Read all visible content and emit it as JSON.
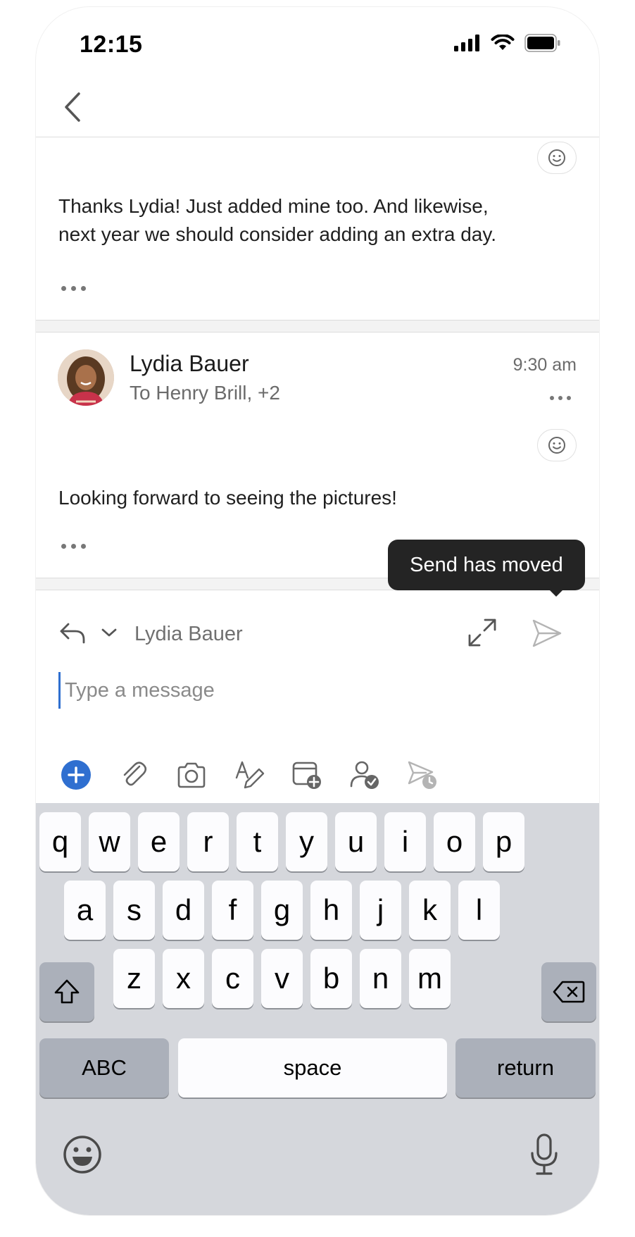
{
  "status_bar": {
    "time": "12:15"
  },
  "messages": [
    {
      "body": [
        "Thanks Lydia! Just added mine too. And likewise,",
        "next year we should consider adding an extra day."
      ]
    },
    {
      "sender": "Lydia Bauer",
      "recipients": "To Henry Brill, +2",
      "time": "9:30 am",
      "body": [
        "Looking forward to seeing the pictures!"
      ]
    }
  ],
  "tooltip": {
    "text": "Send has moved"
  },
  "compose": {
    "reply_to": "Lydia Bauer",
    "placeholder": "Type a message",
    "toolbar": [
      "add-icon",
      "attachment-icon",
      "camera-icon",
      "format-text-icon",
      "calendar-add-icon",
      "availability-icon",
      "schedule-send-icon"
    ]
  },
  "keyboard": {
    "row1": [
      "q",
      "w",
      "e",
      "r",
      "t",
      "y",
      "u",
      "i",
      "o",
      "p"
    ],
    "row2": [
      "a",
      "s",
      "d",
      "f",
      "g",
      "h",
      "j",
      "k",
      "l"
    ],
    "row3": [
      "z",
      "x",
      "c",
      "v",
      "b",
      "n",
      "m"
    ],
    "abc_label": "ABC",
    "space_label": "space",
    "return_label": "return"
  },
  "colors": {
    "accent": "#2f6fd0",
    "tooltip_bg": "#242424",
    "keyboard_bg": "#d5d7dc"
  }
}
